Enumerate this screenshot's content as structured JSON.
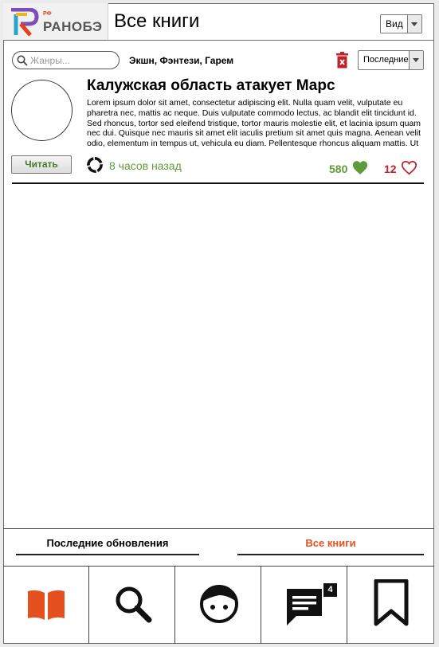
{
  "app": {
    "logo_text": "РАНОБЭ",
    "logo_superscript": "РФ",
    "title": "Все книги"
  },
  "header": {
    "view_select": {
      "selected": "Вид"
    }
  },
  "filters": {
    "search_placeholder": "Жанры...",
    "selected_genres": "Экшн, Фэнтези, Гарем",
    "sort_select": {
      "selected": "Последние"
    }
  },
  "book": {
    "title": "Калужская область атакует Марс",
    "description": "Lorem ipsum dolor sit amet, consectetur adipiscing elit. Nulla quam velit, vulputate eu pharetra nec, mattis ac neque. Duis vulputate commodo lectus, ac blandit elit tincidunt id. Sed rhoncus, tortor sed eleifend tristique, tortor mauris molestie elit, et lacinia ipsum quam nec dui. Quisque nec mauris sit amet elit iaculis pretium sit amet quis magna. Aenean velit odio, elementum in tempus ut, vehicula eu diam. Pellentesque rhoncus aliquam mattis. Ut",
    "read_label": "Читать",
    "updated": "8 часов назад",
    "likes": "580",
    "favorites": "12"
  },
  "tabs": [
    {
      "label": "Последние обновления",
      "active": false
    },
    {
      "label": "Все книги",
      "active": true
    }
  ],
  "nav": {
    "items": [
      {
        "icon": "book-icon"
      },
      {
        "icon": "search-icon"
      },
      {
        "icon": "profile-icon"
      },
      {
        "icon": "messages-icon",
        "badge": "4"
      },
      {
        "icon": "bookmark-icon"
      }
    ]
  },
  "colors": {
    "accent": "#e4511e",
    "green": "#5f9a3c",
    "red": "#c0222b"
  }
}
